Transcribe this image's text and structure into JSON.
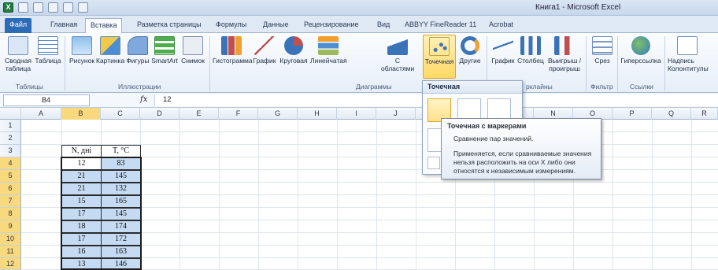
{
  "window": {
    "title": "Книга1 - Microsoft Excel"
  },
  "tabs": [
    {
      "label": "Файл"
    },
    {
      "label": "Главная"
    },
    {
      "label": "Вставка"
    },
    {
      "label": "Разметка страницы"
    },
    {
      "label": "Формулы"
    },
    {
      "label": "Данные"
    },
    {
      "label": "Рецензирование"
    },
    {
      "label": "Вид"
    },
    {
      "label": "ABBYY FineReader 11"
    },
    {
      "label": "Acrobat"
    }
  ],
  "ribbon": {
    "buttons": {
      "pivot": "Сводная таблица",
      "table": "Таблица",
      "picture": "Рисунок",
      "clipart": "Картинка",
      "shapes": "Фигуры",
      "smartart": "SmartArt",
      "screenshot": "Снимок",
      "histogram": "Гистограмма",
      "line": "График",
      "pie": "Круговая",
      "bar": "Линейчатая",
      "area": "С областями",
      "scatter": "Точечная",
      "other": "Другие",
      "spark_line": "График",
      "spark_col": "Столбец",
      "spark_win": "Выигрыш / проигрыш",
      "slicer": "Срез",
      "hyperlink": "Гиперссылка",
      "textbox": "Надпись",
      "textbox_extra": "Колонтитулы"
    },
    "groups": {
      "tables": "Таблицы",
      "illustrations": "Иллюстрации",
      "charts": "Диаграммы",
      "sparklines": "рклайны",
      "filter": "Фильтр",
      "links": "Ссылки"
    }
  },
  "formula_bar": {
    "cell_ref": "B4",
    "fx": "fx",
    "value": "12"
  },
  "columns": [
    "A",
    "B",
    "C",
    "D",
    "E",
    "F",
    "G",
    "H",
    "I",
    "J",
    "K",
    "L",
    "M",
    "N",
    "O",
    "P",
    "Q",
    "R"
  ],
  "rows": [
    "1",
    "2",
    "3",
    "4",
    "5",
    "6",
    "7",
    "8",
    "9",
    "10",
    "11",
    "12"
  ],
  "table": {
    "headers": [
      "N, дні",
      "T, °C"
    ],
    "rows": [
      [
        "12",
        "83"
      ],
      [
        "21",
        "145"
      ],
      [
        "21",
        "132"
      ],
      [
        "15",
        "165"
      ],
      [
        "17",
        "145"
      ],
      [
        "18",
        "174"
      ],
      [
        "17",
        "172"
      ],
      [
        "16",
        "163"
      ],
      [
        "13",
        "146"
      ]
    ]
  },
  "dropdown": {
    "title": "Точечная"
  },
  "tooltip": {
    "title": "Точечная с маркерами",
    "line1": "Сравнение пар значений.",
    "line2": "Применяется, если сравниваемые значения",
    "line3": "нельзя расположить на оси X либо они",
    "line4": "относятся к независимым измерениям."
  }
}
